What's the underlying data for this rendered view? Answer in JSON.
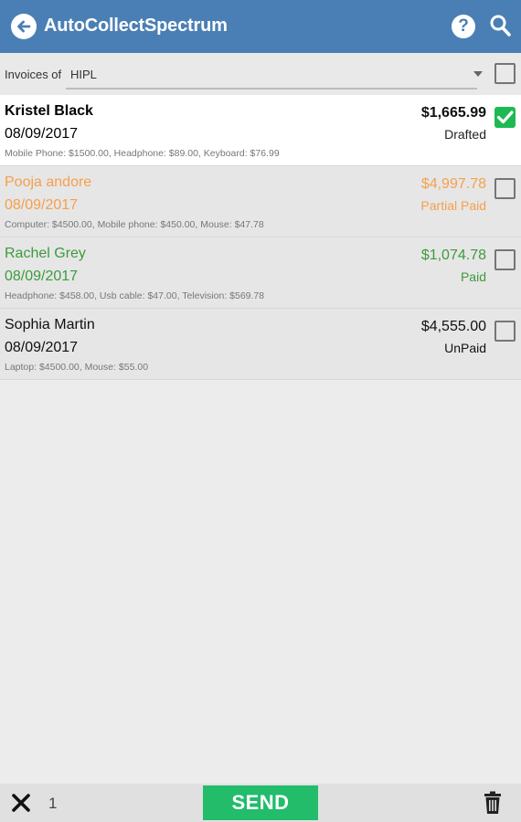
{
  "app": {
    "title": "AutoCollectSpectrum",
    "help_label": "?"
  },
  "filter": {
    "label": "Invoices of",
    "company": "HIPL",
    "select_all_checked": false
  },
  "colors": {
    "appbar": "#4a7fb5",
    "accent_green": "#22bc6b",
    "partial_paid": "#f5a04b",
    "paid": "#3d9a3d",
    "default_text": "#111111"
  },
  "invoices": [
    {
      "name": "Kristel Black",
      "date": "08/09/2017",
      "items": "Mobile Phone: $1500.00, Headphone: $89.00, Keyboard: $76.99",
      "amount": "$1,665.99",
      "status": "Drafted",
      "checked": true,
      "color": "#000000",
      "bold_name": true
    },
    {
      "name": "Pooja andore",
      "date": "08/09/2017",
      "items": "Computer: $4500.00, Mobile phone: $450.00, Mouse: $47.78",
      "amount": "$4,997.78",
      "status": "Partial Paid",
      "checked": false,
      "color": "#f5a04b",
      "bold_name": false
    },
    {
      "name": "Rachel Grey",
      "date": "08/09/2017",
      "items": "Headphone: $458.00, Usb cable: $47.00, Television: $569.78",
      "amount": "$1,074.78",
      "status": "Paid",
      "checked": false,
      "color": "#3d9a3d",
      "bold_name": false
    },
    {
      "name": "Sophia Martin",
      "date": "08/09/2017",
      "items": "Laptop: $4500.00, Mouse: $55.00",
      "amount": "$4,555.00",
      "status": "UnPaid",
      "checked": false,
      "color": "#111111",
      "bold_name": false
    }
  ],
  "bottom": {
    "selected_count": "1",
    "send_label": "SEND"
  }
}
